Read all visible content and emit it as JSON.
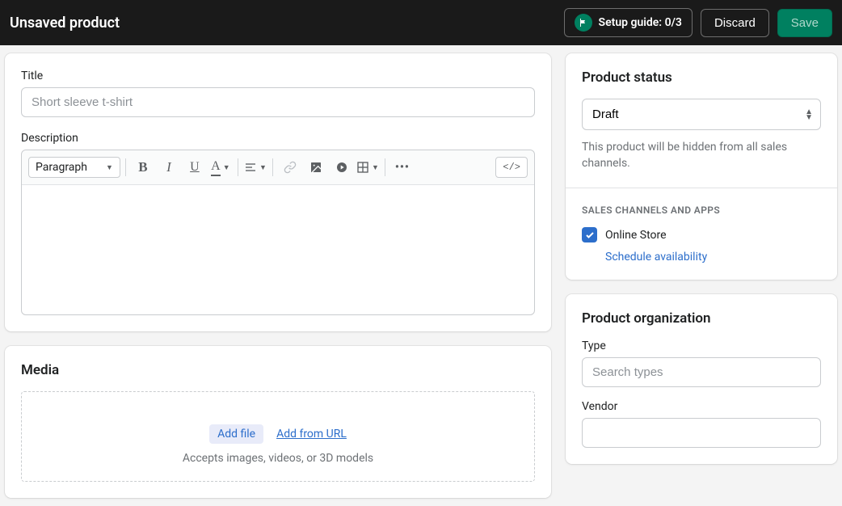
{
  "topbar": {
    "title": "Unsaved product",
    "setup_label": "Setup guide: 0/3",
    "discard_label": "Discard",
    "save_label": "Save"
  },
  "title_field": {
    "label": "Title",
    "placeholder": "Short sleeve t-shirt",
    "value": ""
  },
  "description": {
    "label": "Description",
    "format_dropdown": "Paragraph"
  },
  "media": {
    "heading": "Media",
    "add_file": "Add file",
    "add_url": "Add from URL",
    "help": "Accepts images, videos, or 3D models"
  },
  "status": {
    "heading": "Product status",
    "selected": "Draft",
    "help": "This product will be hidden from all sales channels."
  },
  "channels": {
    "section_label": "SALES CHANNELS AND APPS",
    "online_store": "Online Store",
    "schedule": "Schedule availability"
  },
  "organization": {
    "heading": "Product organization",
    "type_label": "Type",
    "type_placeholder": "Search types",
    "vendor_label": "Vendor"
  }
}
